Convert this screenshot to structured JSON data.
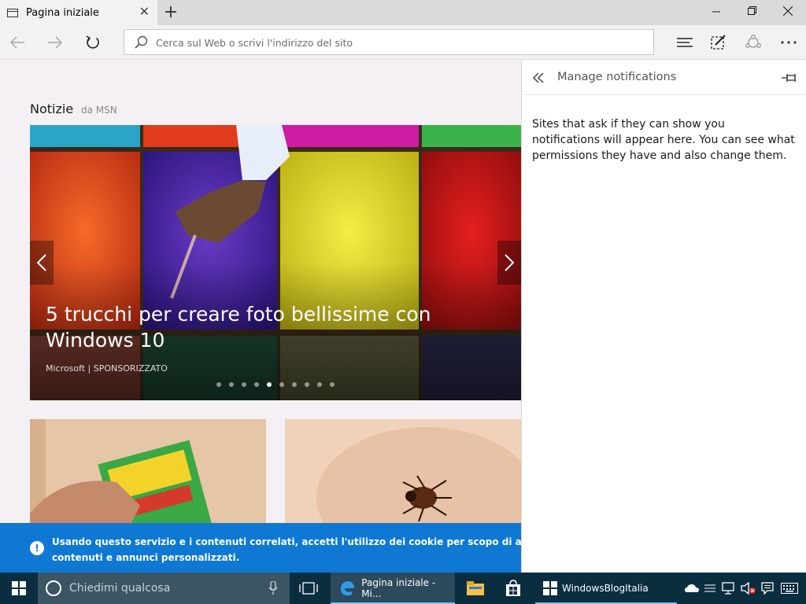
{
  "browser": {
    "tab_title": "Pagina iniziale",
    "new_tab_symbol": "+",
    "tab_close_symbol": "✕",
    "address_placeholder": "Cerca sul Web o scrivi l'indirizzo del sito"
  },
  "news": {
    "title": "Notizie",
    "source": "da MSN",
    "hero_caption": "5 trucchi per creare foto bellissime con Windows 10",
    "hero_source": "Microsoft | SPONSORIZZATO",
    "slides_count": 10,
    "active_slide": 4
  },
  "cookie_banner": {
    "text_line1": "Usando questo servizio e i contenuti correlati, accetti l'utilizzo dei cookie per scopo di analisi e per fo",
    "text_line2": "contenuti e annunci personalizzati."
  },
  "panel": {
    "title": "Manage notifications",
    "description": "Sites that ask if they can show you notifications will appear here. You can see what permissions they have and also change them."
  },
  "taskbar": {
    "search_placeholder": "Chiedimi qualcosa",
    "edge_label": "Pagina iniziale - Mi...",
    "app_label": "WindowsBlogItalia"
  },
  "colors": {
    "accent": "#0f78d2",
    "taskbar": "#0b2d40"
  }
}
